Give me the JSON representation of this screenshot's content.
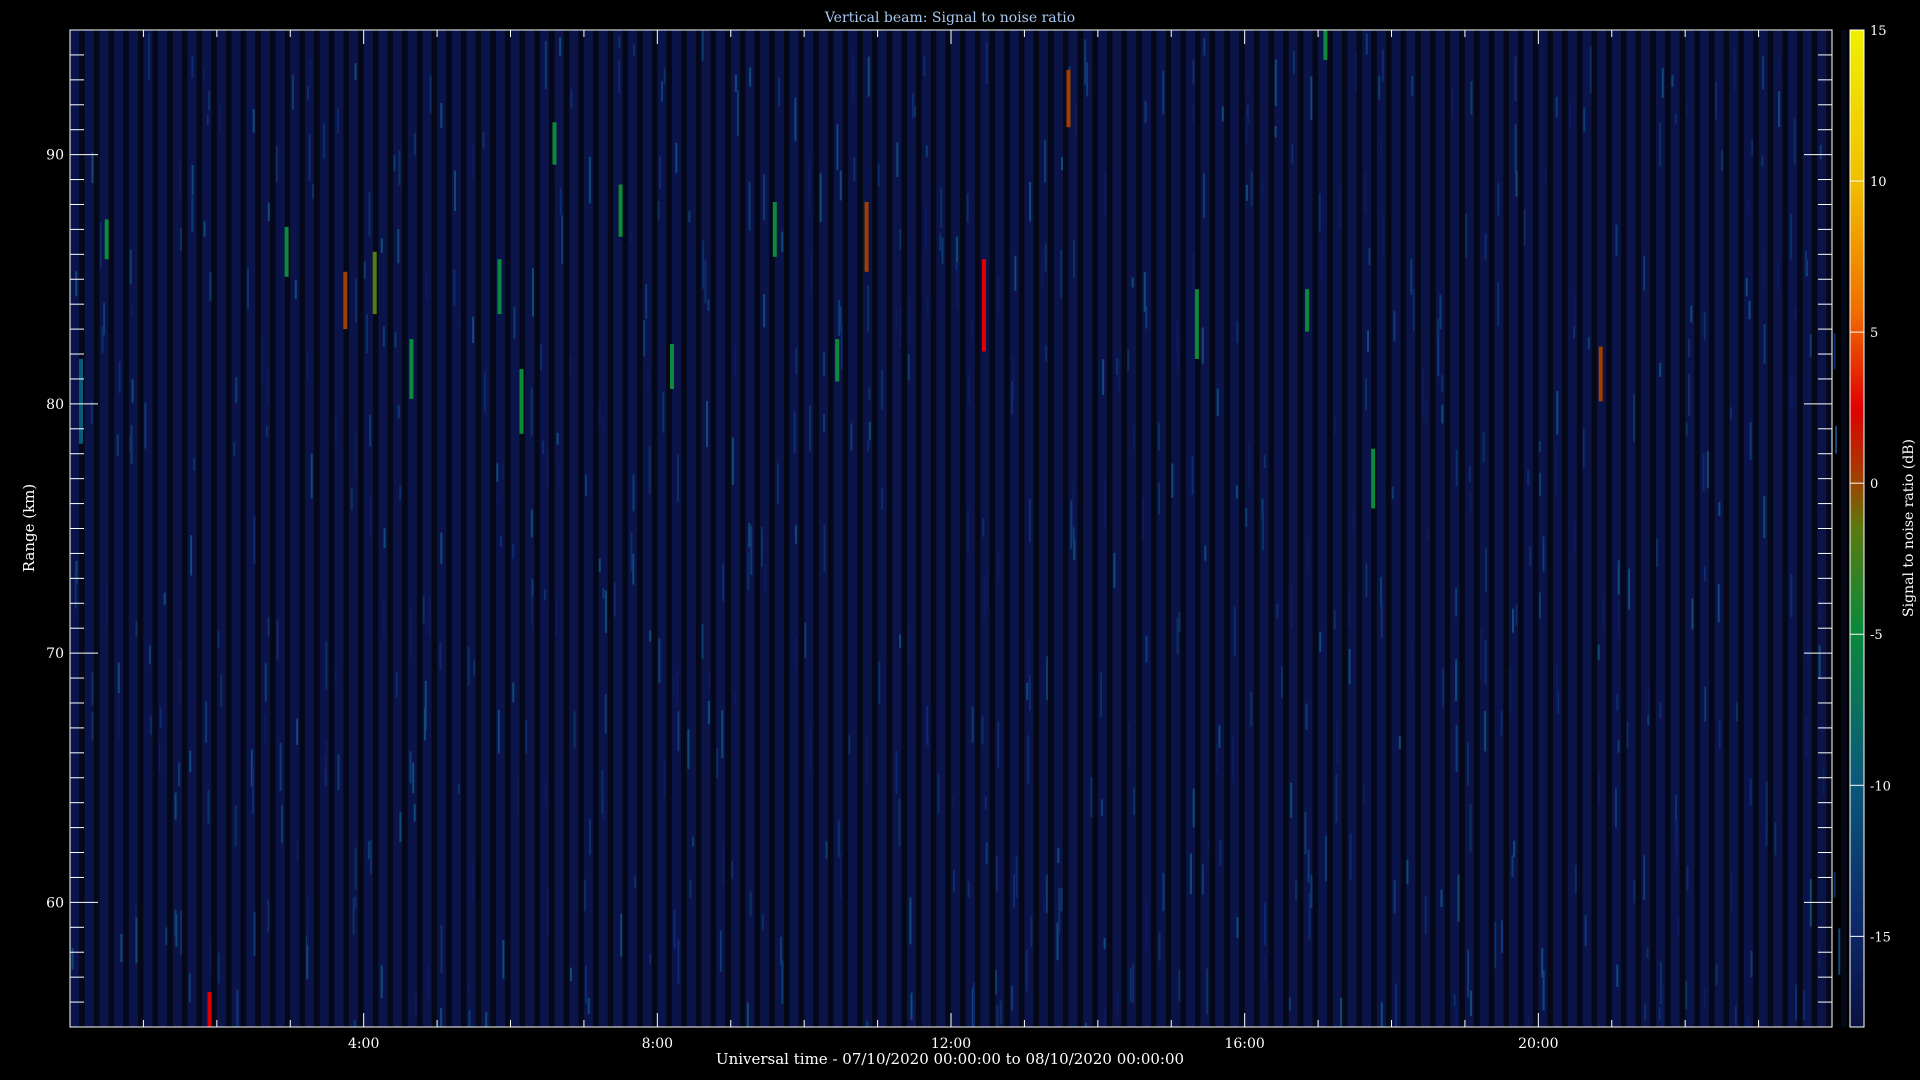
{
  "chart_data": {
    "type": "heatmap",
    "title": "Vertical beam: Signal to noise ratio",
    "xlabel": "Universal time - 07/10/2020 00:00:00 to 08/10/2020 00:00:00",
    "ylabel": "Range (km)",
    "colorbar_label": "Signal to noise ratio (dB)",
    "xlim_hours": [
      0,
      24
    ],
    "ylim_km": [
      55,
      95
    ],
    "x_ticks": [
      {
        "value": 4,
        "label": "4:00"
      },
      {
        "value": 8,
        "label": "8:00"
      },
      {
        "value": 12,
        "label": "12:00"
      },
      {
        "value": 16,
        "label": "16:00"
      },
      {
        "value": 20,
        "label": "20:00"
      }
    ],
    "y_ticks": [
      {
        "value": 60,
        "label": "60"
      },
      {
        "value": 70,
        "label": "70"
      },
      {
        "value": 80,
        "label": "80"
      },
      {
        "value": 90,
        "label": "90"
      }
    ],
    "colorbar_range_db": [
      -18,
      15
    ],
    "colorbar_ticks": [
      {
        "value": 15,
        "label": "15"
      },
      {
        "value": 10,
        "label": "10"
      },
      {
        "value": 5,
        "label": "5"
      },
      {
        "value": 0,
        "label": "0"
      },
      {
        "value": -5,
        "label": "-5"
      },
      {
        "value": -10,
        "label": "-10"
      },
      {
        "value": -15,
        "label": "-15"
      }
    ],
    "background_snr_db": -16,
    "column_interval_hours": 0.2,
    "colormap": [
      "#0a1040",
      "#0c2a6a",
      "#0a5a7a",
      "#0a8a3a",
      "#5a7a10",
      "#a04000",
      "#e00000",
      "#f07000",
      "#f0c000",
      "#f0f000"
    ],
    "strong_echoes": [
      {
        "time": 0.15,
        "range_top": 81.8,
        "range_bottom": 78.4,
        "snr": -9
      },
      {
        "time": 0.5,
        "range_top": 87.4,
        "range_bottom": 85.8,
        "snr": -6
      },
      {
        "time": 1.9,
        "range_top": 56.4,
        "range_bottom": 55,
        "snr": 3
      },
      {
        "time": 2.95,
        "range_top": 87.1,
        "range_bottom": 85.1,
        "snr": -6
      },
      {
        "time": 3.75,
        "range_top": 85.3,
        "range_bottom": 83,
        "snr": 1
      },
      {
        "time": 4.15,
        "range_top": 86.1,
        "range_bottom": 83.6,
        "snr": -4
      },
      {
        "time": 4.65,
        "range_top": 82.6,
        "range_bottom": 80.2,
        "snr": -6
      },
      {
        "time": 5.85,
        "range_top": 85.8,
        "range_bottom": 83.6,
        "snr": -7
      },
      {
        "time": 6.15,
        "range_top": 81.4,
        "range_bottom": 78.8,
        "snr": -6
      },
      {
        "time": 6.6,
        "range_top": 91.3,
        "range_bottom": 89.6,
        "snr": -8
      },
      {
        "time": 7.5,
        "range_top": 88.8,
        "range_bottom": 86.7,
        "snr": -6
      },
      {
        "time": 8.2,
        "range_top": 82.4,
        "range_bottom": 80.6,
        "snr": -6
      },
      {
        "time": 9.6,
        "range_top": 88.1,
        "range_bottom": 85.9,
        "snr": -6
      },
      {
        "time": 10.45,
        "range_top": 82.6,
        "range_bottom": 80.9,
        "snr": -7
      },
      {
        "time": 10.85,
        "range_top": 88.1,
        "range_bottom": 85.3,
        "snr": 1
      },
      {
        "time": 12.45,
        "range_top": 85.8,
        "range_bottom": 82.1,
        "snr": 3
      },
      {
        "time": 13.6,
        "range_top": 93.4,
        "range_bottom": 91.1,
        "snr": 1
      },
      {
        "time": 15.35,
        "range_top": 84.6,
        "range_bottom": 81.8,
        "snr": -8
      },
      {
        "time": 16.85,
        "range_top": 84.6,
        "range_bottom": 82.9,
        "snr": -8
      },
      {
        "time": 17.1,
        "range_top": 95,
        "range_bottom": 93.8,
        "snr": -6
      },
      {
        "time": 17.75,
        "range_top": 78.2,
        "range_bottom": 75.8,
        "snr": -7
      },
      {
        "time": 20.85,
        "range_top": 82.3,
        "range_bottom": 80.1,
        "snr": 0
      }
    ]
  }
}
